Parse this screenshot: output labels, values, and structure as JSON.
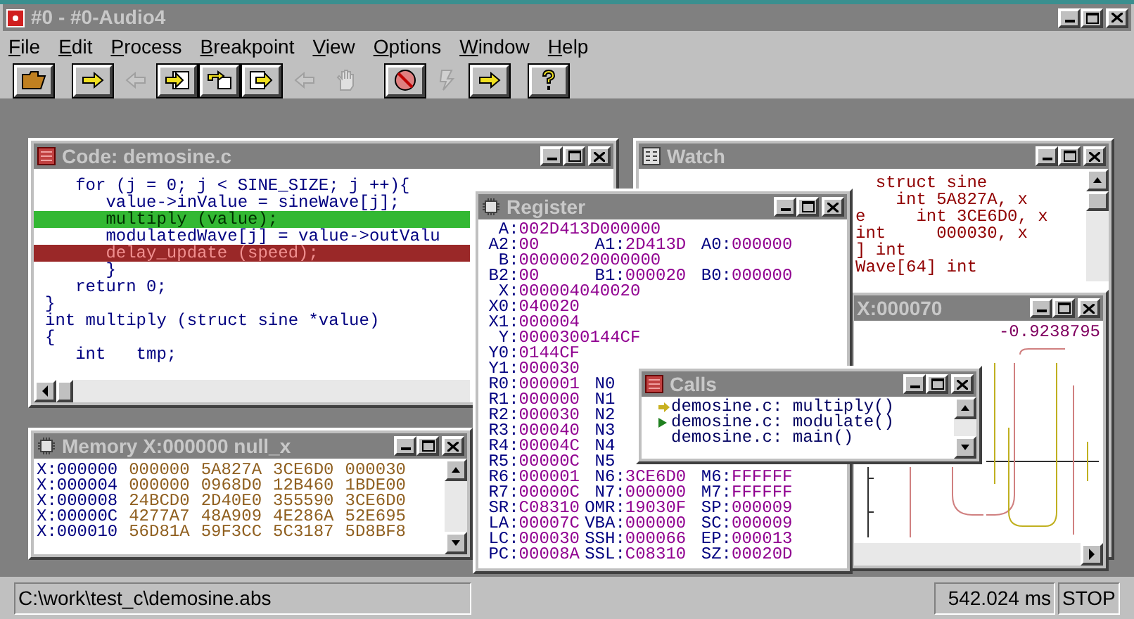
{
  "window": {
    "title": "#0 - #0-Audio4"
  },
  "menu": [
    "File",
    "Edit",
    "Process",
    "Breakpoint",
    "View",
    "Options",
    "Window",
    "Help"
  ],
  "toolbar": [
    [
      {
        "kind": "open",
        "disabled": false
      }
    ],
    [
      {
        "kind": "run",
        "disabled": false
      },
      {
        "kind": "step-back",
        "disabled": true
      },
      {
        "kind": "step-into",
        "disabled": false
      },
      {
        "kind": "step-over",
        "disabled": false
      },
      {
        "kind": "step-out",
        "disabled": false
      },
      {
        "kind": "step-back",
        "disabled": true
      },
      {
        "kind": "hand",
        "disabled": true
      }
    ],
    [
      {
        "kind": "stop",
        "disabled": false
      },
      {
        "kind": "bolt",
        "disabled": true
      },
      {
        "kind": "go",
        "disabled": false
      }
    ],
    [
      {
        "kind": "help",
        "disabled": false
      }
    ]
  ],
  "code": {
    "title": "Code: demosine.c",
    "lines": [
      {
        "text": "   for (j = 0; j < SINE_SIZE; j ++){",
        "kind": "normal"
      },
      {
        "text": "      value->inValue = sineWave[j];",
        "kind": "normal"
      },
      {
        "text": "      multiply (value);",
        "kind": "current"
      },
      {
        "text": "      modulatedWave[j] = value->outValu",
        "kind": "normal"
      },
      {
        "text": "      delay_update (speed);",
        "kind": "breakpoint"
      },
      {
        "text": "      }",
        "kind": "normal"
      },
      {
        "text": "   return 0;",
        "kind": "normal"
      },
      {
        "text": "}",
        "kind": "normal"
      },
      {
        "text": "int multiply (struct sine *value)",
        "kind": "normal"
      },
      {
        "text": "{",
        "kind": "normal"
      },
      {
        "text": "   int   tmp;",
        "kind": "normal"
      }
    ]
  },
  "memory": {
    "title": "Memory X:000000 null_x",
    "rows": [
      {
        "address": "X:000000",
        "values": [
          "000000",
          "5A827A",
          "3CE6D0",
          "000030"
        ]
      },
      {
        "address": "X:000004",
        "values": [
          "000000",
          "0968D0",
          "12B460",
          "1BDE00"
        ]
      },
      {
        "address": "X:000008",
        "values": [
          "24BCD0",
          "2D40E0",
          "355590",
          "3CE6D0"
        ]
      },
      {
        "address": "X:00000C",
        "values": [
          "4277A7",
          "48A909",
          "4E286A",
          "52E695"
        ]
      },
      {
        "address": "X:000010",
        "values": [
          "56D81A",
          "59F3CC",
          "5C3187",
          "5D8BF8"
        ]
      }
    ]
  },
  "watch": {
    "title": "Watch",
    "lines": [
      "  struct sine",
      "    int 5A827A, x",
      "e     int 3CE6D0, x",
      "int     000030, x",
      "] int",
      "Wave[64] int"
    ]
  },
  "plot": {
    "title": "X:000070",
    "reading": "-0.9238795"
  },
  "register": {
    "title": "Register",
    "rows": [
      [
        {
          "label": "A:",
          "value": "002D413D000000"
        }
      ],
      [
        {
          "label": "A2:",
          "value": "00"
        },
        {
          "label": "A1:",
          "value": "2D413D"
        },
        {
          "label": "A0:",
          "value": "000000"
        }
      ],
      [
        {
          "label": "B:",
          "value": "00000020000000"
        }
      ],
      [
        {
          "label": "B2:",
          "value": "00"
        },
        {
          "label": "B1:",
          "value": "000020"
        },
        {
          "label": "B0:",
          "value": "000000"
        }
      ],
      [
        {
          "label": "X:",
          "value": "000004040020"
        }
      ],
      [
        {
          "label": "X0:",
          "value": "040020"
        }
      ],
      [
        {
          "label": "X1:",
          "value": "000004"
        }
      ],
      [
        {
          "label": "Y:",
          "value": "0000300144CF"
        }
      ],
      [
        {
          "label": "Y0:",
          "value": "0144CF"
        }
      ],
      [
        {
          "label": "Y1:",
          "value": "000030"
        }
      ],
      [
        {
          "label": "R0:",
          "value": "000001"
        },
        {
          "label": "N0"
        }
      ],
      [
        {
          "label": "R1:",
          "value": "000000"
        },
        {
          "label": "N1"
        }
      ],
      [
        {
          "label": "R2:",
          "value": "000030"
        },
        {
          "label": "N2"
        }
      ],
      [
        {
          "label": "R3:",
          "value": "000040"
        },
        {
          "label": "N3"
        }
      ],
      [
        {
          "label": "R4:",
          "value": "00004C"
        },
        {
          "label": "N4"
        }
      ],
      [
        {
          "label": "R5:",
          "value": "00000C"
        },
        {
          "label": "N5"
        }
      ],
      [
        {
          "label": "R6:",
          "value": "000001"
        },
        {
          "label": "N6:",
          "value": "3CE6D0"
        },
        {
          "label": "M6:",
          "value": "FFFFFF"
        }
      ],
      [
        {
          "label": "R7:",
          "value": "00000C"
        },
        {
          "label": "N7:",
          "value": "000000"
        },
        {
          "label": "M7:",
          "value": "FFFFFF"
        }
      ],
      [
        {
          "label": "SR:",
          "value": "C08310"
        },
        {
          "label": "OMR:",
          "value": "19030F"
        },
        {
          "label": "SP:",
          "value": "000009"
        }
      ],
      [
        {
          "label": "LA:",
          "value": "00007C"
        },
        {
          "label": "VBA:",
          "value": "000000"
        },
        {
          "label": "SC:",
          "value": "000009"
        }
      ],
      [
        {
          "label": "LC:",
          "value": "000030"
        },
        {
          "label": "SSH:",
          "value": "000066"
        },
        {
          "label": "EP:",
          "value": "000013"
        }
      ],
      [
        {
          "label": "PC:",
          "value": "00008A"
        },
        {
          "label": "SSL:",
          "value": "C08310"
        },
        {
          "label": "SZ:",
          "value": "00020D"
        }
      ]
    ]
  },
  "calls": {
    "title": "Calls",
    "items": [
      {
        "text": "demosine.c: multiply()",
        "kind": "current"
      },
      {
        "text": "demosine.c: modulate()",
        "kind": "caller"
      },
      {
        "text": "demosine.c: main()",
        "kind": "none"
      }
    ]
  },
  "status_bar": {
    "path": "C:\\work\\test_c\\demosine.abs",
    "time": "542.024 ms",
    "state": "STOP"
  }
}
